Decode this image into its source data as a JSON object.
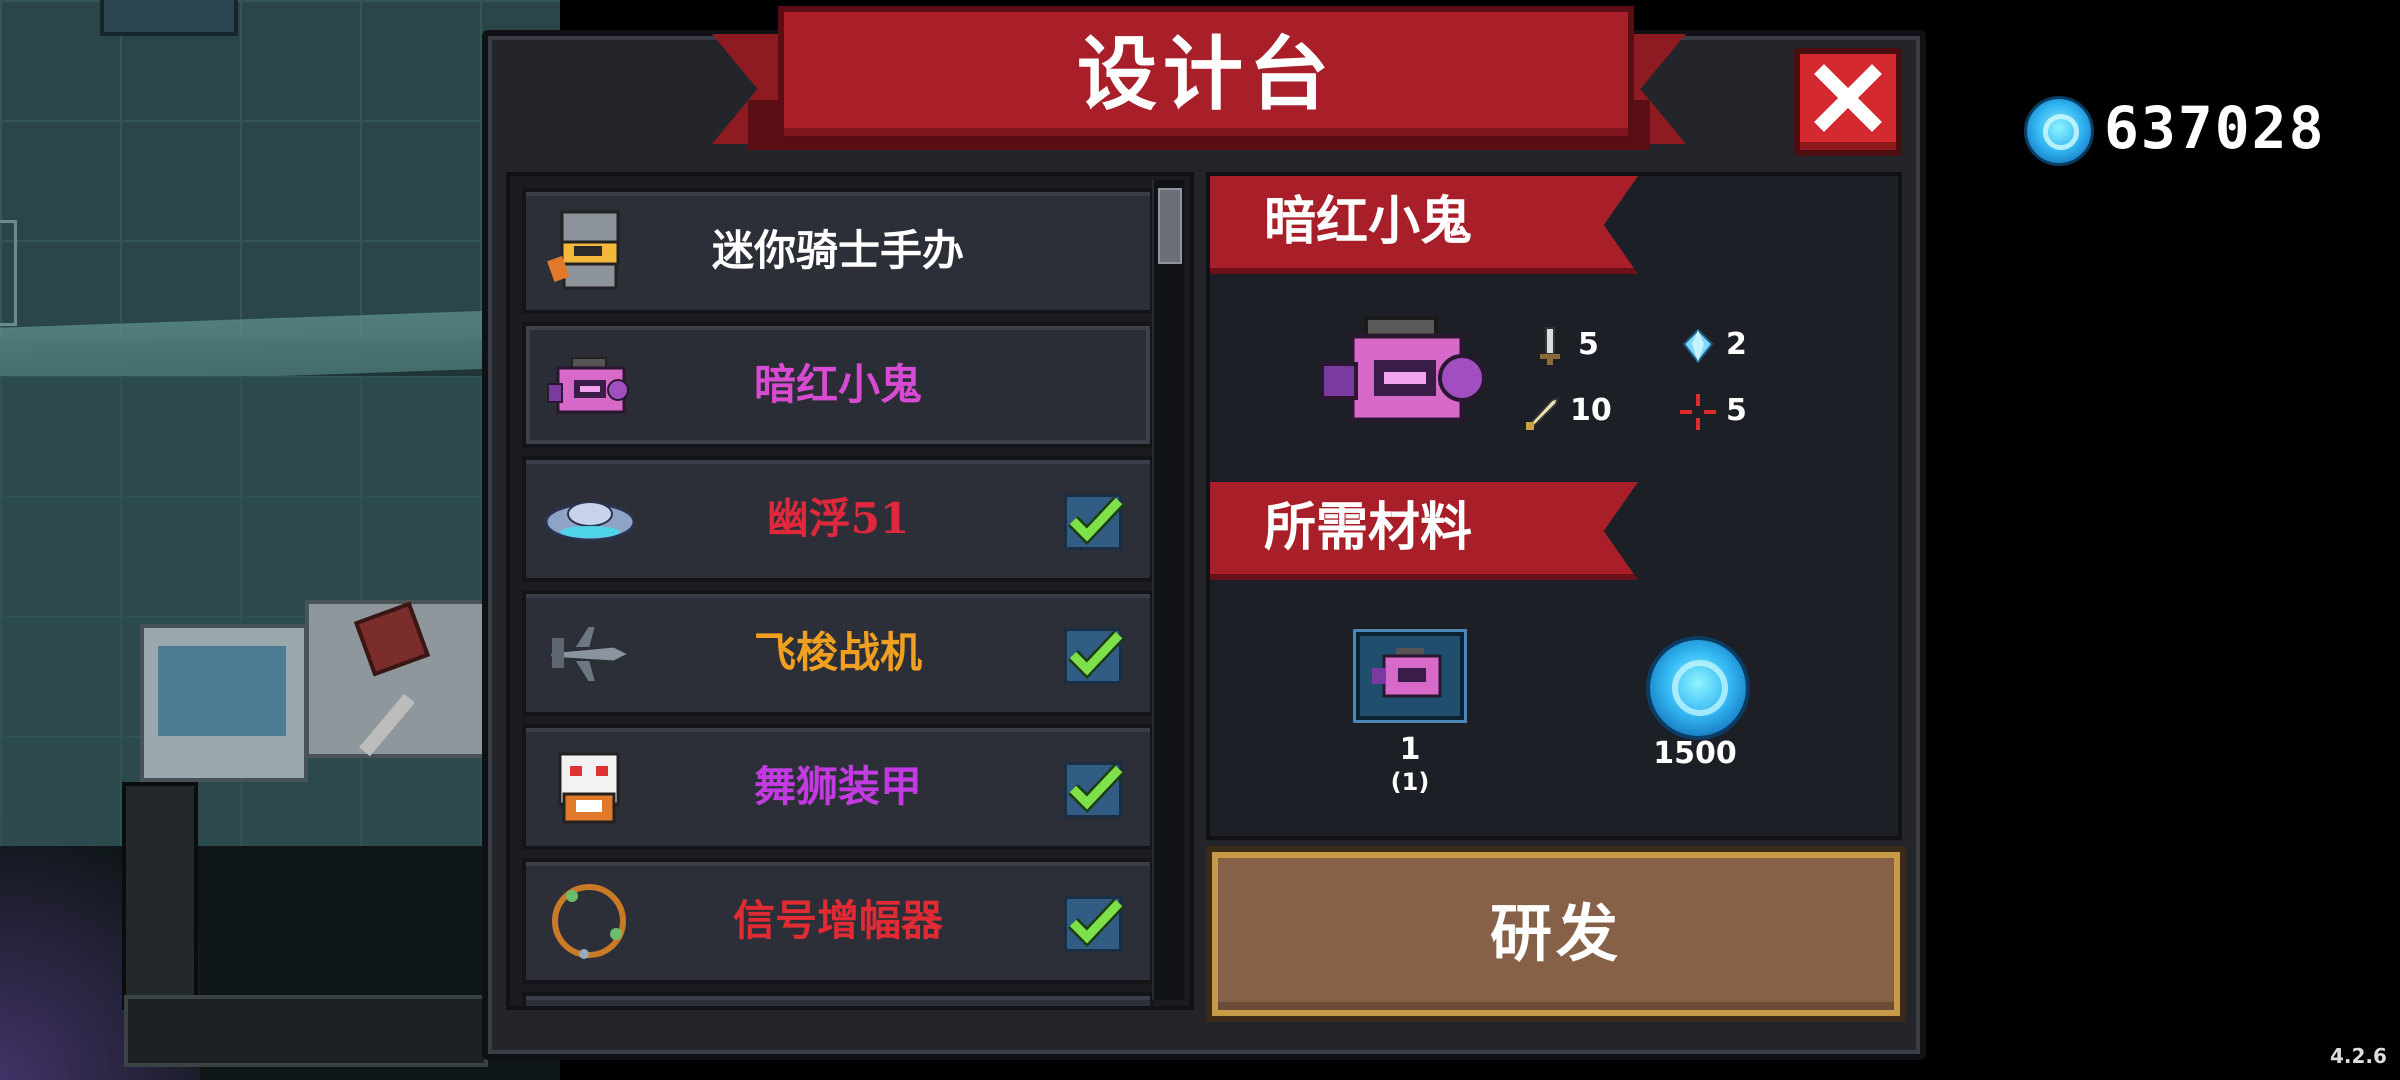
{
  "title": "设计台",
  "currency": {
    "icon": "blue-gem-icon",
    "amount": "637028"
  },
  "version": "4.2.6",
  "list": {
    "items": [
      {
        "name": "迷你骑士手办",
        "color": "#ffffff",
        "icon": "knight-figure-icon",
        "checked": false,
        "selected": false
      },
      {
        "name": "暗红小鬼",
        "color": "#d64bd2",
        "icon": "pink-camera-icon",
        "checked": false,
        "selected": true
      },
      {
        "name": "幽浮51",
        "color": "#e0283c",
        "icon": "ufo-icon",
        "checked": true,
        "selected": false
      },
      {
        "name": "飞梭战机",
        "color": "#f0a020",
        "icon": "jet-fighter-icon",
        "checked": true,
        "selected": false
      },
      {
        "name": "舞狮装甲",
        "color": "#c23be0",
        "icon": "lion-dance-icon",
        "checked": true,
        "selected": false
      },
      {
        "name": "信号增幅器",
        "color": "#e02a34",
        "icon": "signal-ring-icon",
        "checked": true,
        "selected": false
      }
    ]
  },
  "detail": {
    "name": "暗红小鬼",
    "icon": "pink-camera-icon",
    "stats": [
      {
        "icon": "sword-icon",
        "value": "5"
      },
      {
        "icon": "crystal-icon",
        "value": "2"
      },
      {
        "icon": "dagger-icon",
        "value": "10"
      },
      {
        "icon": "crosshair-icon",
        "value": "5"
      }
    ],
    "materials_title": "所需材料",
    "materials": [
      {
        "icon": "pink-camera-blueprint-icon",
        "amount": "1",
        "owned": "(1)"
      },
      {
        "icon": "blue-gem-icon",
        "amount": "1500"
      }
    ],
    "research_label": "研发"
  },
  "colors": {
    "banner": "#a81f2a",
    "panel": "#23252b",
    "button": "#866148",
    "close": "#d42a2f"
  }
}
